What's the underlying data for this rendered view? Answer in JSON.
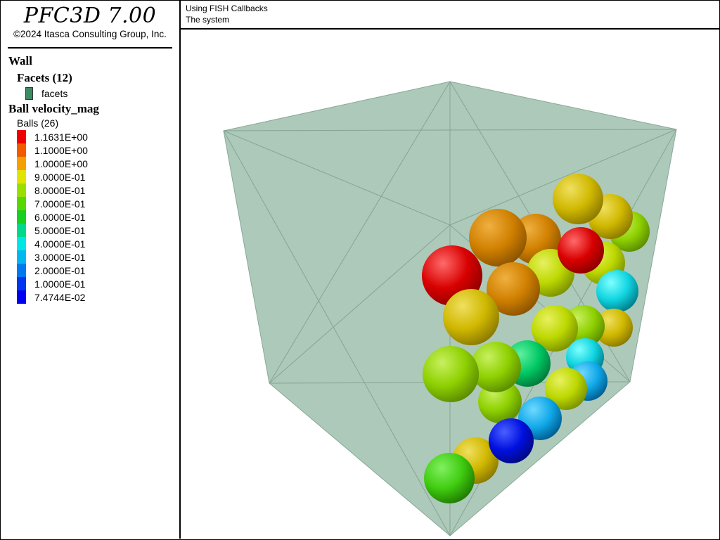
{
  "app": {
    "title": "PFC3D 7.00",
    "copyright": "©2024 Itasca Consulting Group, Inc."
  },
  "header": {
    "line1": "Using FISH Callbacks",
    "line2": "The system"
  },
  "legend": {
    "wall_heading": "Wall",
    "facets_heading": "Facets (12)",
    "facets_label": "facets",
    "facets_color": "#3e8a63",
    "ball_heading": "Ball velocity_mag",
    "balls_label": "Balls (26)",
    "scale": [
      {
        "value": "1.1631E+00",
        "color": "#ee0000"
      },
      {
        "value": "1.1000E+00",
        "color": "#f25a00"
      },
      {
        "value": "1.0000E+00",
        "color": "#f4a000"
      },
      {
        "value": "9.0000E-01",
        "color": "#e0e400"
      },
      {
        "value": "8.0000E-01",
        "color": "#9adf00"
      },
      {
        "value": "7.0000E-01",
        "color": "#58d800"
      },
      {
        "value": "6.0000E-01",
        "color": "#18d020"
      },
      {
        "value": "5.0000E-01",
        "color": "#00d88c"
      },
      {
        "value": "4.0000E-01",
        "color": "#00e6e6"
      },
      {
        "value": "3.0000E-01",
        "color": "#00b8f0"
      },
      {
        "value": "2.0000E-01",
        "color": "#0078f0"
      },
      {
        "value": "1.0000E-01",
        "color": "#0036f0"
      },
      {
        "value": "7.4744E-02",
        "color": "#0000f0"
      }
    ]
  }
}
